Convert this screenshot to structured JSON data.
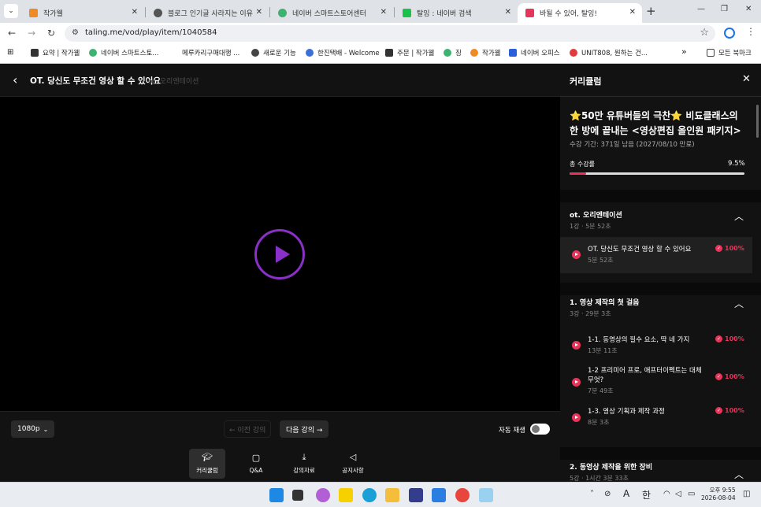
{
  "browser": {
    "tabs": [
      {
        "label": "작가웰",
        "color": "#f08a24",
        "active": false
      },
      {
        "label": "블로그 인기글 사라지는 이유",
        "color": "#555555",
        "active": false
      },
      {
        "label": "네이버 스마트스토어센터",
        "color": "#3cb371",
        "active": false
      },
      {
        "label": "탈잉 : 네이버 검색",
        "color": "#19c24a",
        "active": false
      },
      {
        "label": "바될 수 있어, 탈잉!",
        "color": "#e8345a",
        "active": true
      }
    ],
    "tab_close": "✕",
    "new_tab": "+",
    "url": "taling.me/vod/play/item/1040584",
    "bookmarks": [
      {
        "label": "요약 | 작가웰",
        "color": "#333333"
      },
      {
        "label": "네이버 스마트스토...",
        "color": "#3cb371"
      },
      {
        "label": "메루카리구매대행 ...",
        "color": "#ffffff"
      },
      {
        "label": "새로운 기능",
        "color": "#444444"
      },
      {
        "label": "한진택배 - Welcome",
        "color": "#3a6fd8"
      },
      {
        "label": "주문 | 작가웰",
        "color": "#333333"
      },
      {
        "label": "징",
        "color": "#3cb371"
      },
      {
        "label": "작가웰",
        "color": "#f08a24"
      },
      {
        "label": "네이버 오피스",
        "color": "#2b5fd9"
      },
      {
        "label": "UNIT808, 원하는 건...",
        "color": "#e23b3b"
      }
    ],
    "bookmarks_more": "»",
    "all_bookmarks": "모든 북마크"
  },
  "player": {
    "title": "OT. 당신도 무조건 영상 할 수 있어요",
    "subtitle": "ot. 오리엔테이션",
    "quality": "1080p",
    "prev_label": "← 이전 강의",
    "next_label": "다음 강의 →",
    "autoplay_label": "자동 재생",
    "autoplay_on": false,
    "nav": [
      {
        "label": "커리큘럼",
        "icon": "graduation-cap-icon",
        "active": true
      },
      {
        "label": "Q&A",
        "icon": "chat-bubble-icon",
        "active": false
      },
      {
        "label": "강의자료",
        "icon": "download-icon",
        "active": false
      },
      {
        "label": "공지사항",
        "icon": "megaphone-icon",
        "active": false
      }
    ]
  },
  "curriculum": {
    "header": "커리큘럼",
    "course_title": "⭐50만 유튜버들의 극찬⭐ 비됴클래스의 한 방에 끝내는 <영상편집 올인원 패키지>",
    "period": "수강 기간: 371일 남음 (2027/08/10 만료)",
    "total_label": "총 수강률",
    "total_pct": "9.5%",
    "total_value": 9.5,
    "sections": [
      {
        "title": "ot. 오리엔테이션",
        "meta": "1강 · 5분 52초",
        "lessons": [
          {
            "title": "OT. 당신도 무조건 영상 할 수 있어요",
            "duration": "5분 52초",
            "pct": "100%"
          }
        ]
      },
      {
        "title": "1. 영상 제작의 첫 걸음",
        "meta": "3강 · 29분 3초",
        "lessons": [
          {
            "title": "1-1. 동영상의 필수 요소, 딱 네 가지",
            "duration": "13분 11초",
            "pct": "100%"
          },
          {
            "title": "1-2 프리미어 프로, 애프터이펙트는 대체 무엇?",
            "duration": "7분 49초",
            "pct": "100%"
          },
          {
            "title": "1-3. 영상 기획과 제작 과정",
            "duration": "8분 3초",
            "pct": "100%"
          }
        ]
      },
      {
        "title": "2. 동영상 제작을 위한 장비",
        "meta": "5강 · 1시간 3분 33초",
        "lessons": []
      }
    ]
  },
  "taskbar": {
    "ime": "A",
    "lang": "한",
    "time": "오후 9:55",
    "date": "2026-08-04"
  },
  "colors": {
    "accent": "#e8345a",
    "play": "#8b2fc9"
  }
}
